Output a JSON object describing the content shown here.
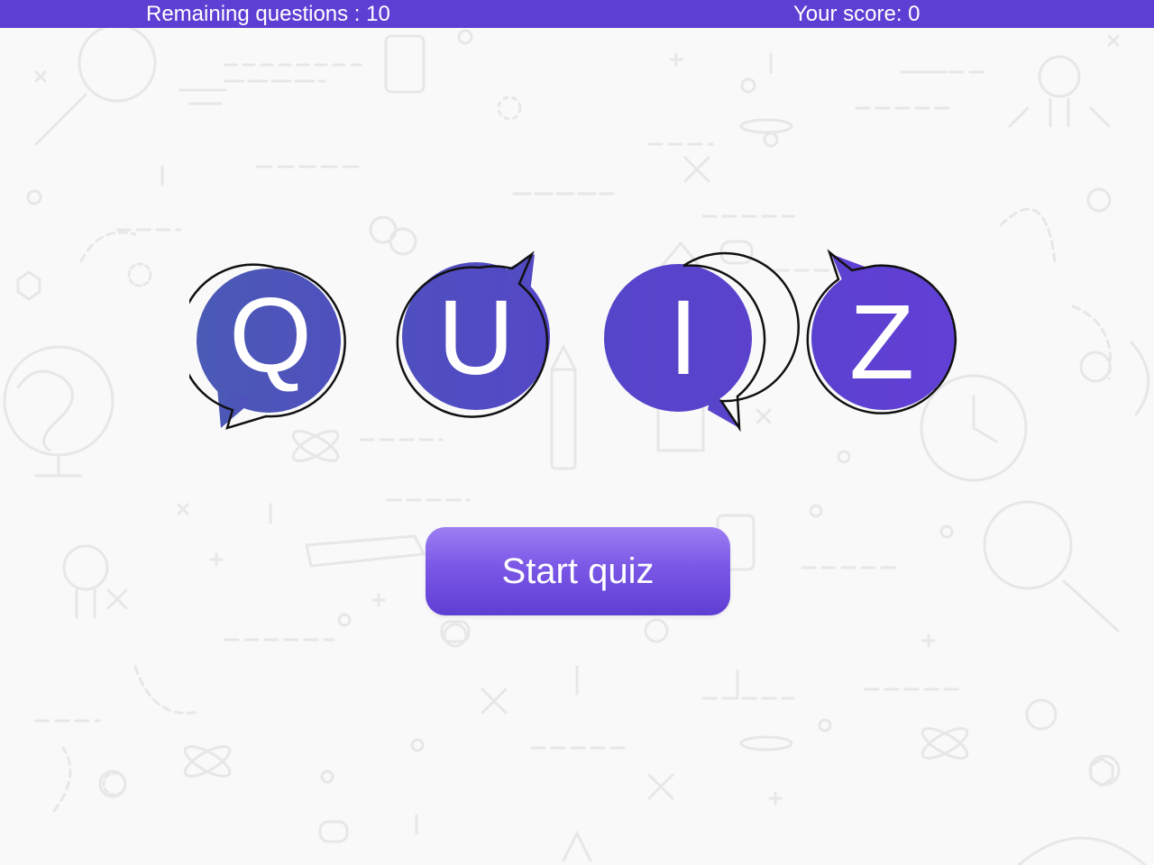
{
  "header": {
    "remaining_label": "Remaining questions : 10",
    "score_label": "Your score: 0"
  },
  "logo": {
    "letters": [
      "Q",
      "U",
      "I",
      "Z"
    ]
  },
  "main": {
    "start_label": "Start quiz"
  },
  "colors": {
    "accent": "#5e3fd3",
    "bubble_blue": "#4a57b8",
    "bubble_purple": "#5f3fd4",
    "button_top": "#9d7ff2",
    "button_bottom": "#5e3fd3"
  }
}
